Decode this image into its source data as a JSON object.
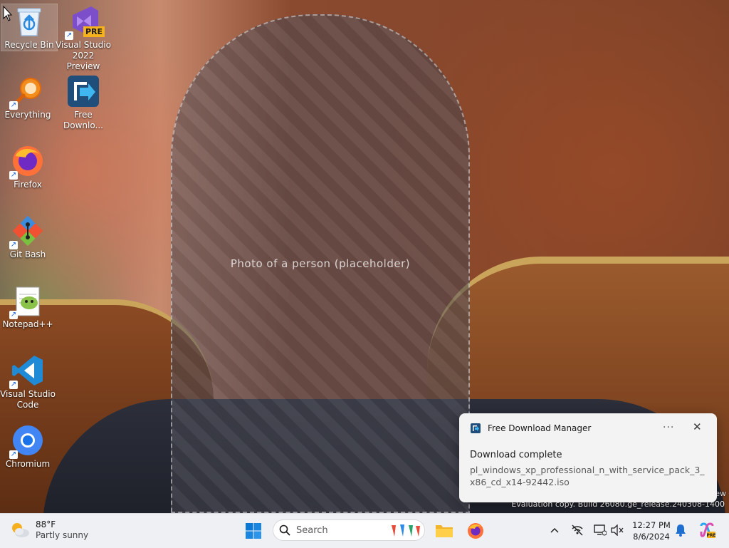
{
  "desktop": {
    "icons": [
      {
        "label": "Recycle Bin",
        "icon": "recycle-bin-icon"
      },
      {
        "label": "Visual Studio 2022 Preview",
        "icon": "visual-studio-preview-icon",
        "badge": "PRE"
      },
      {
        "label": "Everything",
        "icon": "everything-search-icon"
      },
      {
        "label": "Free Downlo...",
        "icon": "free-download-manager-icon"
      },
      {
        "label": "Firefox",
        "icon": "firefox-icon"
      },
      {
        "label": "Git Bash",
        "icon": "git-bash-icon"
      },
      {
        "label": "Notepad++",
        "icon": "notepad-plus-plus-icon"
      },
      {
        "label": "Visual Studio Code",
        "icon": "vscode-icon"
      },
      {
        "label": "Chromium",
        "icon": "chromium-icon"
      }
    ],
    "watermark_line1": "ew",
    "watermark_line2": "Evaluation copy. Build 26080.ge_release.240308-1400"
  },
  "notification": {
    "app_name": "Free Download Manager",
    "more_label": "···",
    "close_label": "✕",
    "title": "Download complete",
    "body": "pl_windows_xp_professional_n_with_service_pack_3_x86_cd_x14-92442.iso"
  },
  "taskbar": {
    "weather": {
      "temperature": "88°F",
      "condition": "Partly sunny"
    },
    "search_placeholder": "Search",
    "clock": {
      "time": "12:27 PM",
      "date": "8/6/2024"
    },
    "pinned": [
      "windows-start-icon",
      "search-icon",
      "file-explorer-icon",
      "firefox-icon"
    ],
    "tray": [
      "chevron-up-icon",
      "network-off-icon",
      "display-icon",
      "volume-muted-icon",
      "notification-bell-icon",
      "copilot-icon"
    ]
  },
  "colors": {
    "accent": "#0067c0",
    "taskbar_bg": "#eef0f3",
    "toast_bg": "#f3f3f3"
  }
}
